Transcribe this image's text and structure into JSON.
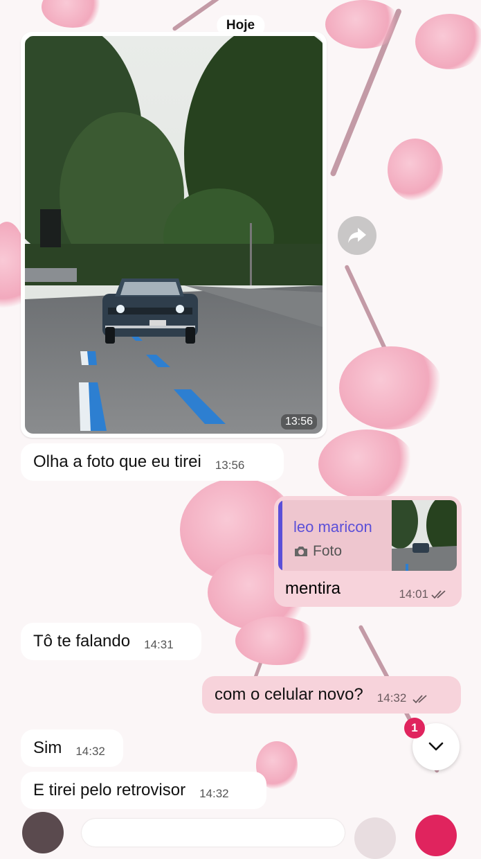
{
  "date_label": "Hoje",
  "photo_message": {
    "time": "13:56"
  },
  "messages": [
    {
      "dir": "in",
      "text": "Olha a foto que eu tirei",
      "time": "13:56"
    },
    {
      "dir": "in",
      "text": "Tô te falando",
      "time": "14:31"
    },
    {
      "dir": "out",
      "text": "com o celular novo?",
      "time": "14:32"
    },
    {
      "dir": "in",
      "text": "Sim",
      "time": "14:32"
    },
    {
      "dir": "in",
      "text": "E tirei pelo retrovisor",
      "time": "14:32"
    }
  ],
  "reply_message": {
    "quoted_name": "leo maricon",
    "quoted_type": "Foto",
    "text": "mentira",
    "time": "14:01"
  },
  "scroll_button": {
    "unread_count": "1"
  },
  "colors": {
    "outgoing_bubble": "#f7d3db",
    "incoming_bubble": "#ffffff",
    "quote_accent": "#5b4fd8",
    "badge": "#e0245e"
  },
  "icons": [
    "forward-icon",
    "camera-icon",
    "double-check-icon",
    "chevron-down-icon"
  ]
}
